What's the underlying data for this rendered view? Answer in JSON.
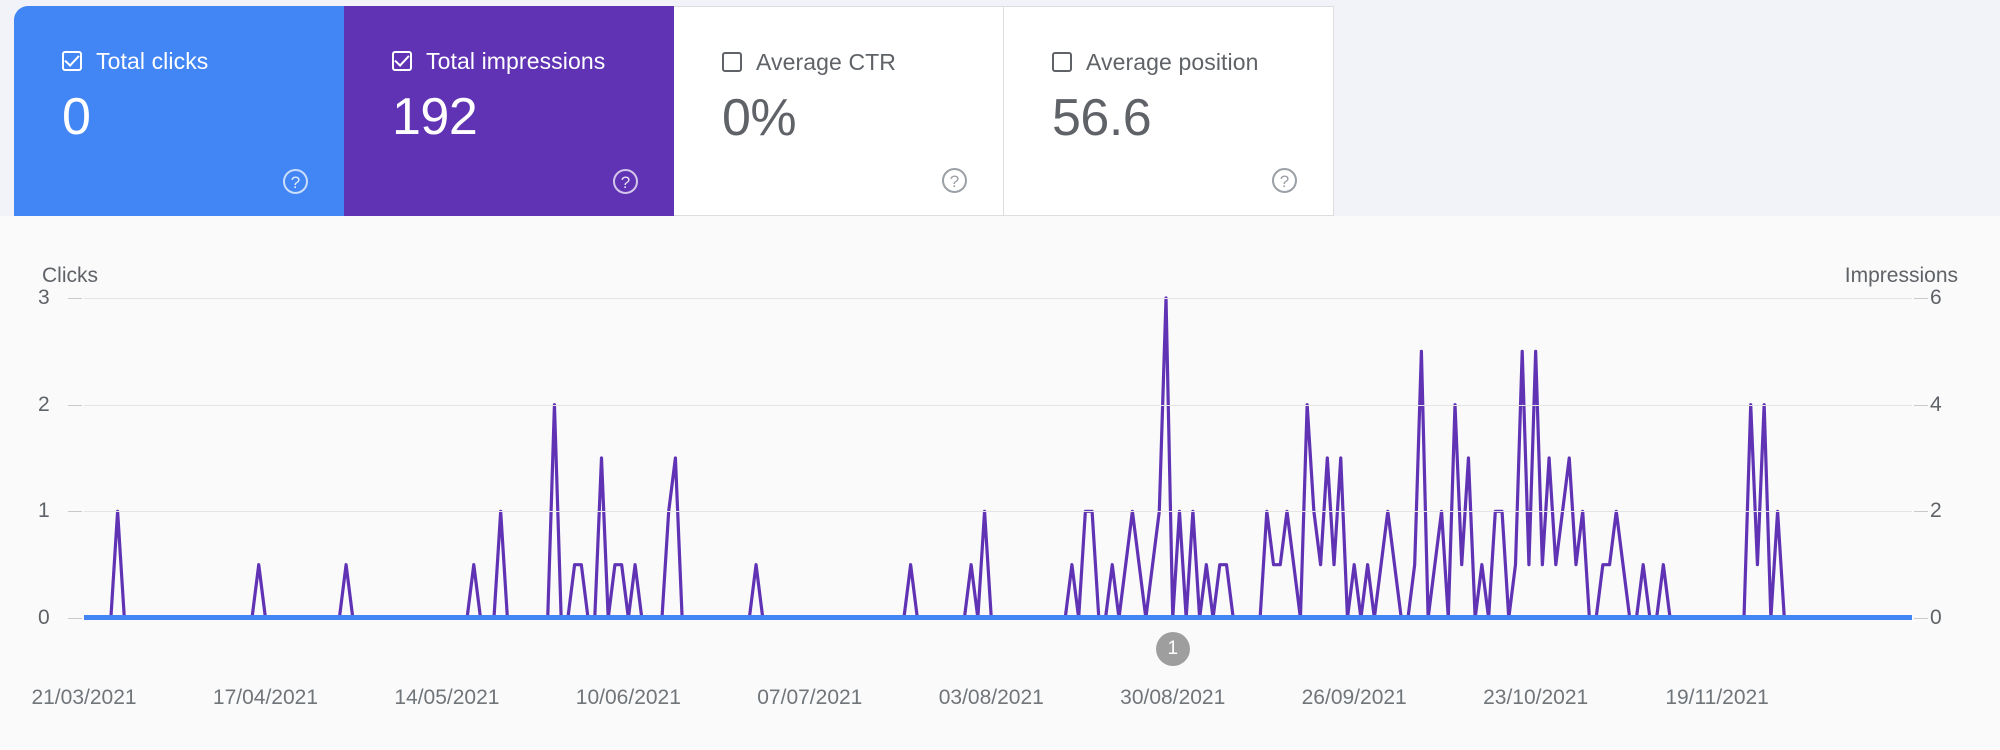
{
  "metrics": [
    {
      "label": "Total clicks",
      "value": "0",
      "checked": true,
      "state": "selected-blue",
      "help": "?"
    },
    {
      "label": "Total impressions",
      "value": "192",
      "checked": true,
      "state": "selected-purple",
      "help": "?"
    },
    {
      "label": "Average CTR",
      "value": "0%",
      "checked": false,
      "state": "unselected",
      "help": "?"
    },
    {
      "label": "Average position",
      "value": "56.6",
      "checked": false,
      "state": "unselected",
      "help": "?"
    }
  ],
  "colors": {
    "clicks_blue": "#4285F4",
    "impressions_purple": "#6033B5",
    "unselected_text": "#5F6368",
    "page_background": "#F1F3F8",
    "chart_background": "#FAFAFA",
    "gridline": "#E4E4E4",
    "event_badge": "#9E9E9E"
  },
  "event_marker": {
    "label": "1",
    "near_date": "30/08/2021"
  },
  "chart_data": {
    "type": "line",
    "title": "",
    "left_axis": {
      "label": "Clicks",
      "ticks": [
        "0",
        "1",
        "2",
        "3"
      ],
      "min": 0,
      "max": 3
    },
    "right_axis": {
      "label": "Impressions",
      "ticks": [
        "0",
        "2",
        "4",
        "6"
      ],
      "min": 0,
      "max": 6
    },
    "grid": true,
    "legend": "none",
    "xlabel": "",
    "ylabel": "Clicks",
    "x_tick_labels": [
      "21/03/2021",
      "17/04/2021",
      "14/05/2021",
      "10/06/2021",
      "07/07/2021",
      "03/08/2021",
      "30/08/2021",
      "26/09/2021",
      "23/10/2021",
      "19/11/2021"
    ],
    "x_start": "21/03/2021",
    "x_end": "16/12/2021",
    "series": [
      {
        "name": "Total clicks",
        "color": "#4285F4",
        "axis": "left",
        "total": 0,
        "values": [
          0,
          0,
          0,
          0,
          0,
          0,
          0,
          0,
          0,
          0,
          0,
          0,
          0,
          0,
          0,
          0,
          0,
          0,
          0,
          0,
          0,
          0,
          0,
          0,
          0,
          0,
          0,
          0,
          0,
          0,
          0,
          0,
          0,
          0,
          0,
          0,
          0,
          0,
          0,
          0,
          0,
          0,
          0,
          0,
          0,
          0,
          0,
          0,
          0,
          0,
          0,
          0,
          0,
          0,
          0,
          0,
          0,
          0,
          0,
          0,
          0,
          0,
          0,
          0,
          0,
          0,
          0,
          0,
          0,
          0,
          0,
          0,
          0,
          0,
          0,
          0,
          0,
          0,
          0,
          0,
          0,
          0,
          0,
          0,
          0,
          0,
          0,
          0,
          0,
          0,
          0,
          0,
          0,
          0,
          0,
          0,
          0,
          0,
          0,
          0,
          0,
          0,
          0,
          0,
          0,
          0,
          0,
          0,
          0,
          0,
          0,
          0,
          0,
          0,
          0,
          0,
          0,
          0,
          0,
          0,
          0,
          0,
          0,
          0,
          0,
          0,
          0,
          0,
          0,
          0,
          0,
          0,
          0,
          0,
          0,
          0,
          0,
          0,
          0,
          0,
          0,
          0,
          0,
          0,
          0,
          0,
          0,
          0,
          0,
          0,
          0,
          0,
          0,
          0,
          0,
          0,
          0,
          0,
          0,
          0,
          0,
          0,
          0,
          0,
          0,
          0,
          0,
          0,
          0,
          0,
          0,
          0,
          0,
          0,
          0,
          0,
          0,
          0,
          0,
          0,
          0,
          0,
          0,
          0,
          0,
          0,
          0,
          0,
          0,
          0,
          0,
          0,
          0,
          0,
          0,
          0,
          0,
          0,
          0,
          0,
          0,
          0,
          0,
          0,
          0,
          0,
          0,
          0,
          0,
          0,
          0,
          0,
          0,
          0,
          0,
          0,
          0,
          0,
          0,
          0,
          0,
          0,
          0,
          0,
          0,
          0,
          0,
          0,
          0,
          0,
          0,
          0,
          0,
          0,
          0,
          0,
          0,
          0,
          0,
          0,
          0,
          0,
          0,
          0,
          0,
          0,
          0,
          0,
          0,
          0,
          0,
          0,
          0,
          0,
          0,
          0,
          0,
          0,
          0,
          0,
          0,
          0,
          0,
          0,
          0,
          0,
          0,
          0,
          0,
          0,
          0,
          0,
          0
        ]
      },
      {
        "name": "Total impressions",
        "color": "#6033B5",
        "axis": "right",
        "total": 192,
        "values": [
          0,
          0,
          0,
          0,
          0,
          2,
          0,
          0,
          0,
          0,
          0,
          0,
          0,
          0,
          0,
          0,
          0,
          0,
          0,
          0,
          0,
          0,
          0,
          0,
          0,
          0,
          1,
          0,
          0,
          0,
          0,
          0,
          0,
          0,
          0,
          0,
          0,
          0,
          0,
          1,
          0,
          0,
          0,
          0,
          0,
          0,
          0,
          0,
          0,
          0,
          0,
          0,
          0,
          0,
          0,
          0,
          0,
          0,
          1,
          0,
          0,
          0,
          2,
          0,
          0,
          0,
          0,
          0,
          0,
          0,
          4,
          0,
          0,
          1,
          1,
          0,
          0,
          3,
          0,
          1,
          1,
          0,
          1,
          0,
          0,
          0,
          0,
          2,
          3,
          0,
          0,
          0,
          0,
          0,
          0,
          0,
          0,
          0,
          0,
          0,
          1,
          0,
          0,
          0,
          0,
          0,
          0,
          0,
          0,
          0,
          0,
          0,
          0,
          0,
          0,
          0,
          0,
          0,
          0,
          0,
          0,
          0,
          0,
          1,
          0,
          0,
          0,
          0,
          0,
          0,
          0,
          0,
          1,
          0,
          2,
          0,
          0,
          0,
          0,
          0,
          0,
          0,
          0,
          0,
          0,
          0,
          0,
          1,
          0,
          2,
          2,
          0,
          0,
          1,
          0,
          1,
          2,
          1,
          0,
          1,
          2,
          6,
          0,
          2,
          0,
          2,
          0,
          1,
          0,
          1,
          1,
          0,
          0,
          0,
          0,
          0,
          2,
          1,
          1,
          2,
          1,
          0,
          4,
          2,
          1,
          3,
          1,
          3,
          0,
          1,
          0,
          1,
          0,
          1,
          2,
          1,
          0,
          0,
          1,
          5,
          0,
          1,
          2,
          0,
          4,
          1,
          3,
          0,
          1,
          0,
          2,
          2,
          0,
          1,
          5,
          1,
          5,
          1,
          3,
          1,
          2,
          3,
          1,
          2,
          0,
          0,
          1,
          1,
          2,
          1,
          0,
          0,
          1,
          0,
          0,
          1,
          0,
          0,
          0,
          0,
          0,
          0,
          0,
          0,
          0,
          0,
          0,
          0,
          4,
          1,
          4,
          0,
          2,
          0,
          0,
          0,
          0,
          0,
          0,
          0,
          0,
          0,
          0,
          0,
          0,
          0,
          0,
          0,
          0,
          0,
          0,
          0,
          0
        ]
      }
    ]
  }
}
